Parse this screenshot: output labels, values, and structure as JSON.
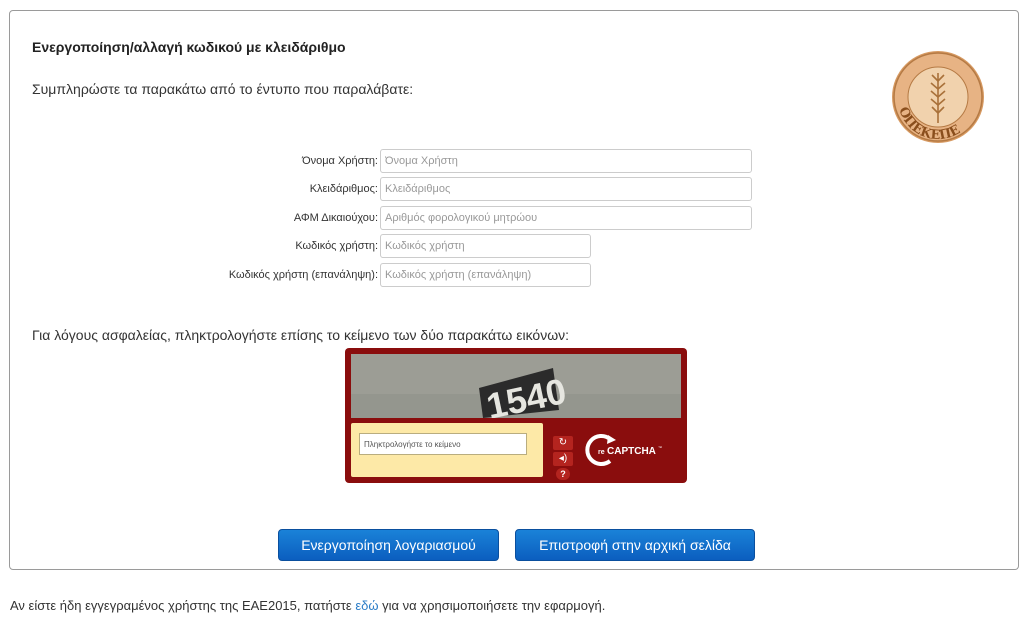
{
  "page": {
    "title": "Ενεργοποίηση/αλλαγή κωδικού με κλειδάριθμο",
    "instructions": "Συμπληρώστε τα παρακάτω από το έντυπο που παραλάβατε:",
    "logo_text": "ΟΠΕΚΕΠΕ"
  },
  "form": {
    "username": {
      "label": "Όνομα Χρήστη:",
      "placeholder": "Όνομα Χρήστη",
      "value": ""
    },
    "keynumber": {
      "label": "Κλειδάριθμος:",
      "placeholder": "Κλειδάριθμος",
      "value": ""
    },
    "afm": {
      "label": "ΑΦΜ Δικαιούχου:",
      "placeholder": "Αριθμός φορολογικού μητρώου",
      "value": ""
    },
    "password": {
      "label": "Κωδικός χρήστη:",
      "placeholder": "Κωδικός χρήστη",
      "value": ""
    },
    "password_repeat": {
      "label": "Κωδικός χρήστη (επανάληψη):",
      "placeholder": "Κωδικός χρήστη (επανάληψη)",
      "value": ""
    }
  },
  "security_text": "Για λόγους ασφαλείας, πληκτρολογήστε επίσης το κείμενο των δύο παρακάτω εικόνων:",
  "captcha": {
    "image_text": "1540",
    "input_placeholder": "Πληκτρολογήστε το κείμενο",
    "refresh_icon": "refresh-icon",
    "audio_icon": "audio-icon",
    "help_icon": "help-icon",
    "brand": "reCAPTCHA",
    "brand_prefix": "re",
    "brand_main": "CAPTCHA",
    "brand_tm": "™"
  },
  "buttons": {
    "activate": "Ενεργοποίηση λογαριασμού",
    "back": "Επιστροφή στην αρχική σελίδα"
  },
  "footer": {
    "before": "Αν είστε ήδη εγγεγραμένος χρήστης της ΕΑΕ2015, πατήστε ",
    "link": "εδώ",
    "after": " για να χρησιμοποιήσετε την εφαρμογή."
  },
  "colors": {
    "button_blue": "#0b5ebf",
    "captcha_red": "#8a0d0d",
    "captcha_yellow": "#fde9a7",
    "link_blue": "#2a7cc7"
  }
}
